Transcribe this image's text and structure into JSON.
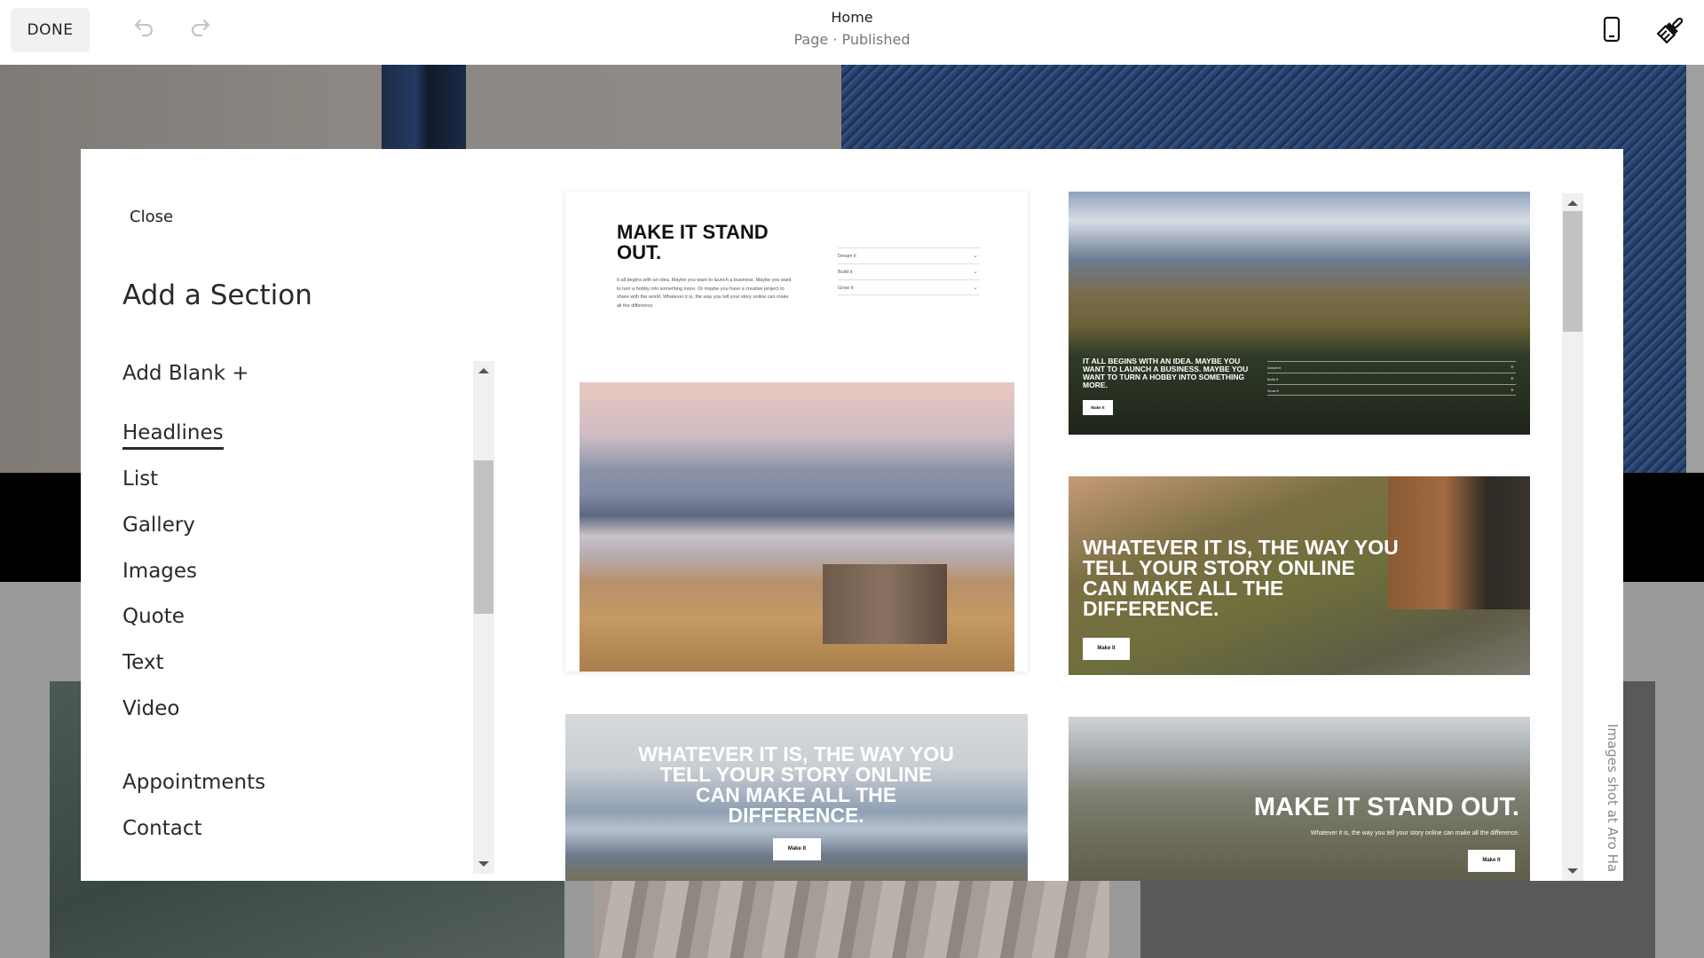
{
  "topbar": {
    "done_label": "DONE",
    "undo_icon": "undo-icon",
    "redo_icon": "redo-icon",
    "page_title": "Home",
    "page_subtitle": "Page · Published",
    "mobile_icon": "mobile-preview-icon",
    "brush_icon": "site-styles-brush-icon"
  },
  "modal": {
    "close_label": "Close",
    "title": "Add a Section",
    "add_blank_label": "Add Blank +",
    "categories": [
      {
        "label": "Headlines",
        "active": true
      },
      {
        "label": "List",
        "active": false
      },
      {
        "label": "Gallery",
        "active": false
      },
      {
        "label": "Images",
        "active": false
      },
      {
        "label": "Quote",
        "active": false
      },
      {
        "label": "Text",
        "active": false
      },
      {
        "label": "Video",
        "active": false
      },
      {
        "label": "Appointments",
        "active": false
      },
      {
        "label": "Contact",
        "active": false
      }
    ],
    "credit": "Images shot at Aro Ha"
  },
  "templates": [
    {
      "headline": "MAKE IT STAND OUT.",
      "body": "It all begins with an idea. Maybe you want to launch a business. Maybe you want to turn a hobby into something more. Or maybe you have a creative project to share with the world. Whatever it is, the way you tell your story online can make all the difference.",
      "accordion": [
        "Dream it",
        "Build it",
        "Grow it"
      ]
    },
    {
      "headline": "IT ALL BEGINS WITH AN IDEA. MAYBE YOU WANT TO LAUNCH A BUSINESS. MAYBE YOU WANT TO TURN A HOBBY INTO SOMETHING MORE.",
      "button": "Make It",
      "accordion": [
        "Dream it",
        "Build it",
        "Grow it"
      ]
    },
    {
      "headline": "WHATEVER IT IS, THE WAY YOU TELL YOUR STORY ONLINE CAN MAKE ALL THE DIFFERENCE.",
      "button": "Make It"
    },
    {
      "headline": "WHATEVER IT IS, THE WAY YOU TELL YOUR STORY ONLINE CAN MAKE ALL THE DIFFERENCE.",
      "button": "Make It"
    },
    {
      "headline": "MAKE IT STAND OUT.",
      "body": "Whatever it is, the way you tell your story online can make all the difference.",
      "button": "Make It"
    }
  ]
}
